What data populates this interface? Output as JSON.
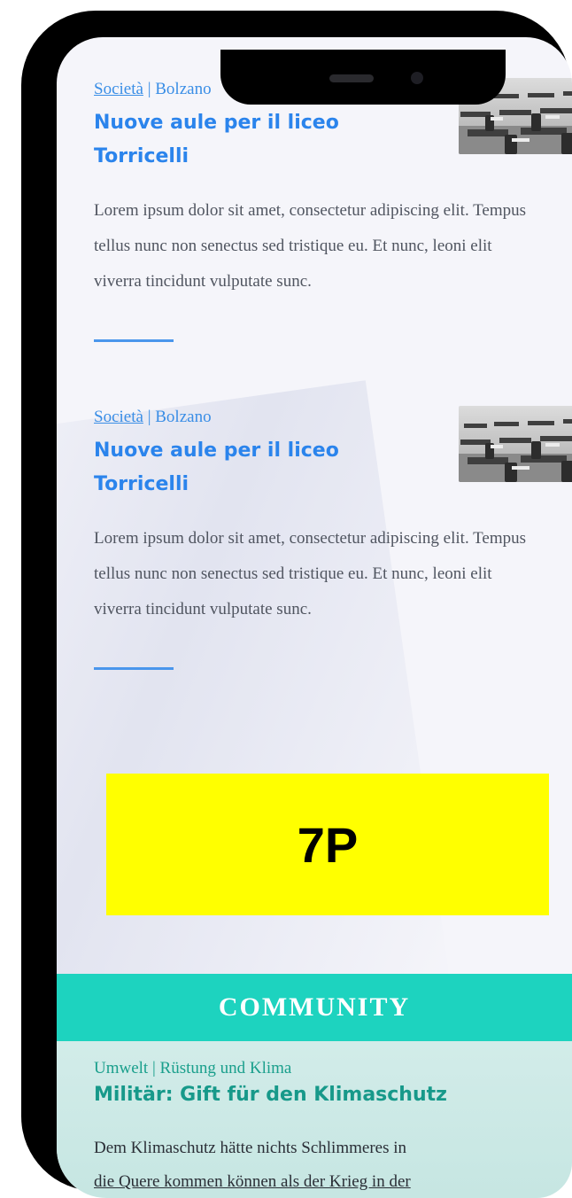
{
  "articles": [
    {
      "category": "Società",
      "separator": " | ",
      "location": "Bolzano",
      "title": "Nuove aule per il liceo Torricelli",
      "excerpt": "Lorem ipsum dolor sit amet, consectetur adipiscing elit. Tempus  tellus nunc non senectus sed tristique eu. Et nunc, leoni elit viverra tincidunt vulputate sunc."
    },
    {
      "category": "Società",
      "separator": " | ",
      "location": "Bolzano",
      "title": "Nuove aule per il liceo Torricelli",
      "excerpt": "Lorem ipsum dolor sit amet, consectetur adipiscing elit. Tempus  tellus nunc non senectus sed tristique eu. Et nunc, leoni elit viverra tincidunt vulputate sunc."
    }
  ],
  "ad": {
    "label": "7P"
  },
  "community": {
    "heading": "COMMUNITY",
    "kicker": "Umwelt | Rüstung und Klima",
    "title": "Militär: Gift für den Klimaschutz",
    "body_line1": "Dem Klimaschutz hätte nichts Schlimmeres in",
    "body_line2": "die Quere kommen können als der Krieg in der"
  },
  "colors": {
    "link_blue": "#2b84ec",
    "accent_teal": "#1dd3bf",
    "ad_yellow": "#ffff00",
    "comment_icon": "#1dd3bf"
  },
  "icons": {
    "comment": "chat-bubble-dots-icon"
  }
}
